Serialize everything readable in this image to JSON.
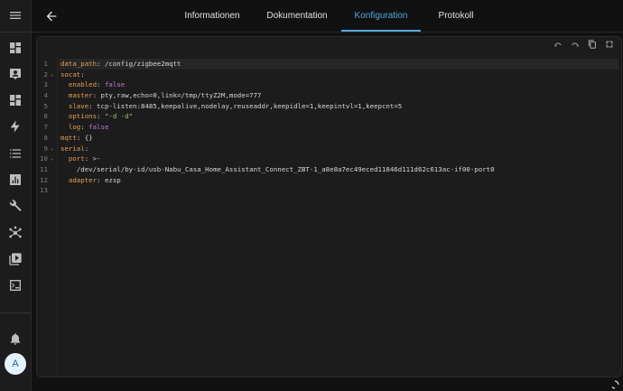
{
  "tabs": [
    {
      "label": "Informationen"
    },
    {
      "label": "Dokumentation"
    },
    {
      "label": "Konfiguration"
    },
    {
      "label": "Protokoll"
    }
  ],
  "active_tab": "Konfiguration",
  "user": {
    "initial": "A"
  },
  "sidebar_icons": [
    "menu-icon",
    "dashboard-icon",
    "map-icon",
    "logbook-icon",
    "energy-icon",
    "history-icon",
    "statistics-icon",
    "settings-wrench-icon",
    "developer-tools-icon",
    "media-icon",
    "terminal-icon",
    "notifications-bell-icon"
  ],
  "editor": {
    "lines": [
      {
        "n": "1",
        "fold": "",
        "tokens": [
          {
            "t": "data_path",
            "c": "k"
          },
          {
            "t": ": /config/zigbee2mqtt",
            "c": "plain"
          }
        ]
      },
      {
        "n": "2",
        "fold": "⌄",
        "tokens": [
          {
            "t": "socat",
            "c": "k"
          },
          {
            "t": ":",
            "c": "plain"
          }
        ]
      },
      {
        "n": "3",
        "fold": "",
        "tokens": [
          {
            "t": "  enabled",
            "c": "k"
          },
          {
            "t": ": ",
            "c": "plain"
          },
          {
            "t": "false",
            "c": "bool"
          }
        ]
      },
      {
        "n": "4",
        "fold": "",
        "tokens": [
          {
            "t": "  master",
            "c": "k"
          },
          {
            "t": ": pty,raw,echo=0,link=/tmp/ttyZ2M,mode=777",
            "c": "plain"
          }
        ]
      },
      {
        "n": "5",
        "fold": "",
        "tokens": [
          {
            "t": "  slave",
            "c": "k"
          },
          {
            "t": ": tcp-listen:8485,keepalive,nodelay,reuseaddr,keepidle=1,keepintvl=1,keepcnt=5",
            "c": "plain"
          }
        ]
      },
      {
        "n": "6",
        "fold": "",
        "tokens": [
          {
            "t": "  options",
            "c": "k"
          },
          {
            "t": ": ",
            "c": "plain"
          },
          {
            "t": "\"-d -d\"",
            "c": "str"
          }
        ]
      },
      {
        "n": "7",
        "fold": "",
        "tokens": [
          {
            "t": "  log",
            "c": "k"
          },
          {
            "t": ": ",
            "c": "plain"
          },
          {
            "t": "false",
            "c": "bool"
          }
        ]
      },
      {
        "n": "8",
        "fold": "",
        "tokens": [
          {
            "t": "mqtt",
            "c": "k"
          },
          {
            "t": ": {}",
            "c": "plain"
          }
        ]
      },
      {
        "n": "9",
        "fold": "⌄",
        "tokens": [
          {
            "t": "serial",
            "c": "k"
          },
          {
            "t": ":",
            "c": "plain"
          }
        ]
      },
      {
        "n": "10",
        "fold": "⌄",
        "tokens": [
          {
            "t": "  port",
            "c": "k"
          },
          {
            "t": ": >-",
            "c": "plain"
          }
        ]
      },
      {
        "n": "11",
        "fold": "",
        "tokens": [
          {
            "t": "    /dev/serial/by-id/usb-Nabu_Casa_Home_Assistant_Connect_ZBT-1_a8e8a7ec49eced11846d111d62c613ac-if00-port0",
            "c": "plain"
          }
        ]
      },
      {
        "n": "12",
        "fold": "",
        "tokens": [
          {
            "t": "  adapter",
            "c": "k"
          },
          {
            "t": ": ezsp",
            "c": "plain"
          }
        ]
      },
      {
        "n": "13",
        "fold": "",
        "tokens": []
      }
    ],
    "toolbar": [
      "undo-icon",
      "redo-icon",
      "copy-icon",
      "fullscreen-icon"
    ]
  }
}
